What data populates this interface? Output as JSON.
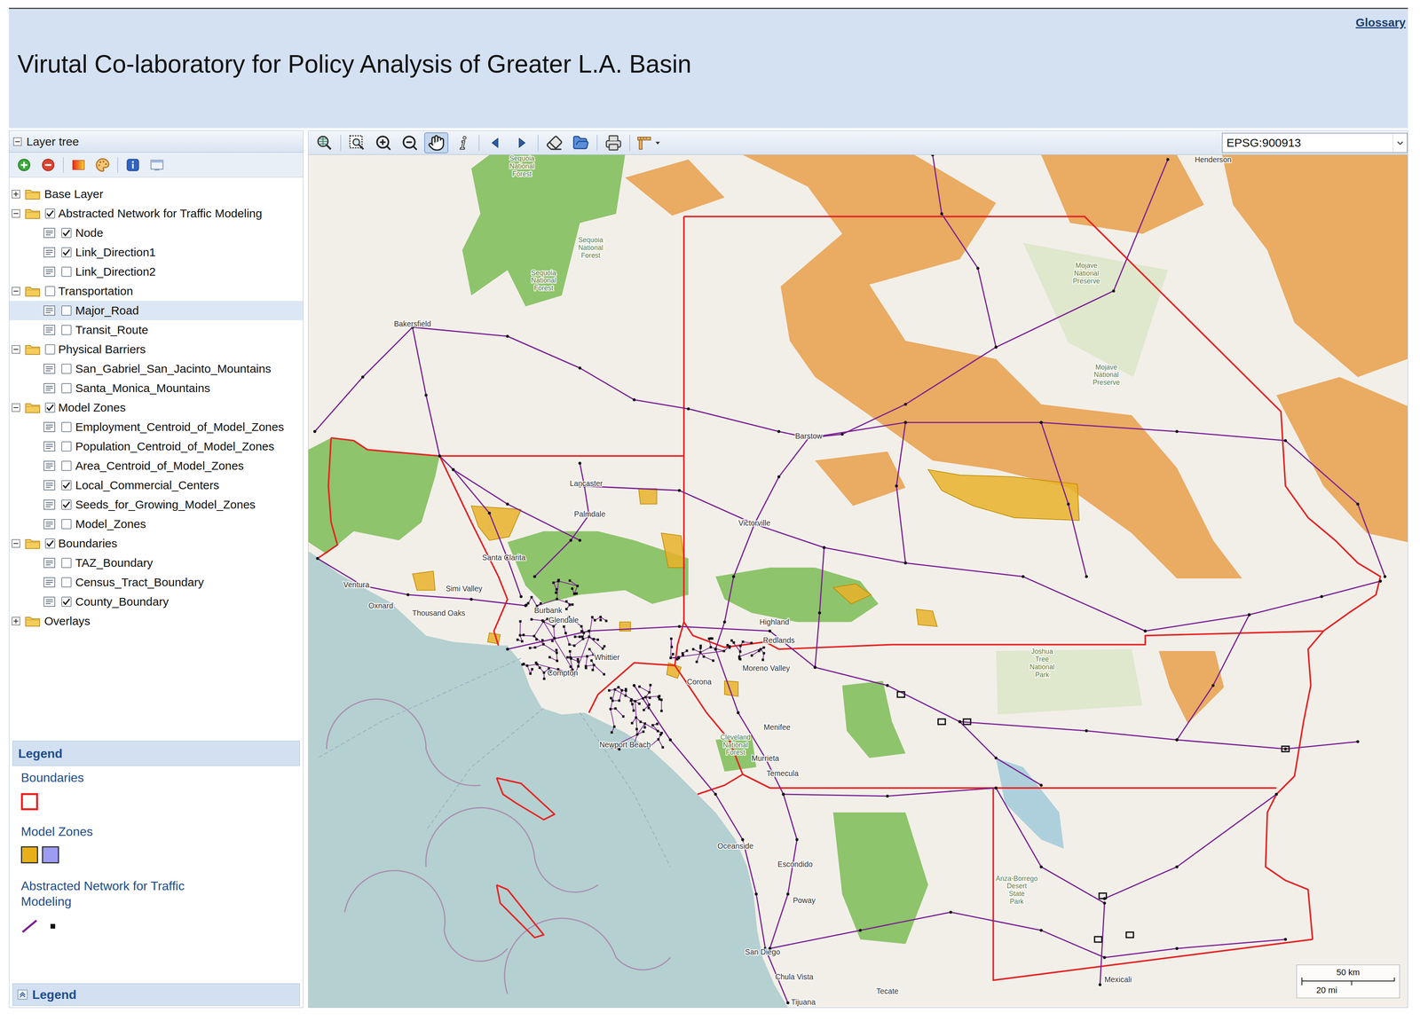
{
  "header": {
    "title": "Virutal Co-laboratory for Policy Analysis of Greater L.A. Basin",
    "glossary": "Glossary"
  },
  "layer_tree": {
    "title": "Layer tree",
    "expanded": true,
    "tools": [
      {
        "kind": "add"
      },
      {
        "kind": "remove"
      },
      {
        "kind": "color"
      },
      {
        "kind": "style"
      },
      {
        "kind": "info"
      },
      {
        "kind": "window"
      }
    ],
    "items": [
      {
        "label": "Base Layer",
        "kind": "group",
        "expanded": false,
        "selected": false
      },
      {
        "label": "Abstracted Network for Traffic Modeling",
        "kind": "folder",
        "expanded": true,
        "checked": true,
        "selected": false
      },
      {
        "label": "Node",
        "kind": "layer",
        "checked": true,
        "selected": false
      },
      {
        "label": "Link_Direction1",
        "kind": "layer",
        "checked": true,
        "selected": false
      },
      {
        "label": "Link_Direction2",
        "kind": "layer",
        "checked": false,
        "selected": false
      },
      {
        "label": "Transportation",
        "kind": "folder",
        "expanded": true,
        "checked": false,
        "selected": false
      },
      {
        "label": "Major_Road",
        "kind": "layer",
        "checked": false,
        "selected": true
      },
      {
        "label": "Transit_Route",
        "kind": "layer",
        "checked": false,
        "selected": false
      },
      {
        "label": "Physical Barriers",
        "kind": "folder",
        "expanded": true,
        "checked": false,
        "selected": false
      },
      {
        "label": "San_Gabriel_San_Jacinto_Mountains",
        "kind": "layer",
        "checked": false,
        "selected": false
      },
      {
        "label": "Santa_Monica_Mountains",
        "kind": "layer",
        "checked": false,
        "selected": false
      },
      {
        "label": "Model Zones",
        "kind": "folder",
        "expanded": true,
        "checked": true,
        "selected": false
      },
      {
        "label": "Employment_Centroid_of_Model_Zones",
        "kind": "layer",
        "checked": false,
        "selected": false
      },
      {
        "label": "Population_Centroid_of_Model_Zones",
        "kind": "layer",
        "checked": false,
        "selected": false
      },
      {
        "label": "Area_Centroid_of_Model_Zones",
        "kind": "layer",
        "checked": false,
        "selected": false
      },
      {
        "label": "Local_Commercial_Centers",
        "kind": "layer",
        "checked": true,
        "selected": false
      },
      {
        "label": "Seeds_for_Growing_Model_Zones",
        "kind": "layer",
        "checked": true,
        "selected": false
      },
      {
        "label": "Model_Zones",
        "kind": "layer",
        "checked": false,
        "selected": false
      },
      {
        "label": "Boundaries",
        "kind": "folder",
        "expanded": true,
        "checked": true,
        "selected": false
      },
      {
        "label": "TAZ_Boundary",
        "kind": "layer",
        "checked": false,
        "selected": false
      },
      {
        "label": "Census_Tract_Boundary",
        "kind": "layer",
        "checked": false,
        "selected": false
      },
      {
        "label": "County_Boundary",
        "kind": "layer",
        "checked": true,
        "selected": false
      },
      {
        "label": "Overlays",
        "kind": "group",
        "expanded": false,
        "selected": false
      }
    ]
  },
  "legend": {
    "title": "Legend",
    "footer": "Legend",
    "sections": [
      {
        "title": "Boundaries",
        "swatches": [
          {
            "kind": "outline",
            "color": "#e82323"
          }
        ]
      },
      {
        "title": "Model Zones",
        "swatches": [
          {
            "kind": "fill",
            "color": "#e8b018"
          },
          {
            "kind": "fill",
            "color": "#9c9cf2"
          }
        ]
      },
      {
        "title": "Abstracted Network for Traffic Modeling",
        "swatches": [
          {
            "kind": "line",
            "color": "#7b1f94"
          },
          {
            "kind": "dot",
            "color": "#111111"
          }
        ]
      }
    ]
  },
  "map_toolbar": {
    "tool_groups": [
      [
        {
          "kind": "zoom-extent",
          "selected": false
        }
      ],
      [
        {
          "kind": "zoom-box",
          "selected": false
        },
        {
          "kind": "zoom-in",
          "selected": false
        },
        {
          "kind": "zoom-out",
          "selected": false
        },
        {
          "kind": "pan",
          "selected": true
        },
        {
          "kind": "info",
          "selected": false
        }
      ],
      [
        {
          "kind": "back",
          "selected": false
        },
        {
          "kind": "forward",
          "selected": false
        }
      ],
      [
        {
          "kind": "clear",
          "selected": false
        },
        {
          "kind": "open",
          "selected": false
        }
      ],
      [
        {
          "kind": "print",
          "selected": false
        }
      ],
      [
        {
          "kind": "measure",
          "selected": false
        }
      ]
    ],
    "projection": "EPSG:900913"
  },
  "map": {
    "labels": [
      {
        "text": "Henderson",
        "kind": "city"
      },
      {
        "text": "Sequoia National Forest",
        "kind": "park"
      },
      {
        "text": "Sequoia National Forest",
        "kind": "park"
      },
      {
        "text": "Sequoia National Forest",
        "kind": "park"
      },
      {
        "text": "Mojave National Preserve",
        "kind": "park"
      },
      {
        "text": "Mojave National Preserve",
        "kind": "park"
      },
      {
        "text": "Bakersfield",
        "kind": "city"
      },
      {
        "text": "Barstow",
        "kind": "city"
      },
      {
        "text": "Lancaster",
        "kind": "city"
      },
      {
        "text": "Palmdale",
        "kind": "city"
      },
      {
        "text": "Victorville",
        "kind": "city"
      },
      {
        "text": "Santa Clarita",
        "kind": "city"
      },
      {
        "text": "Ventura",
        "kind": "city"
      },
      {
        "text": "Oxnard",
        "kind": "city"
      },
      {
        "text": "Simi Valley",
        "kind": "city"
      },
      {
        "text": "Thousand Oaks",
        "kind": "city"
      },
      {
        "text": "Burbank",
        "kind": "city"
      },
      {
        "text": "Glendale",
        "kind": "city"
      },
      {
        "text": "Highland",
        "kind": "city"
      },
      {
        "text": "Redlands",
        "kind": "city"
      },
      {
        "text": "Moreno Valley",
        "kind": "city"
      },
      {
        "text": "Corona",
        "kind": "city"
      },
      {
        "text": "Compton",
        "kind": "city"
      },
      {
        "text": "Whittier",
        "kind": "city"
      },
      {
        "text": "Menifee",
        "kind": "city"
      },
      {
        "text": "Murrieta",
        "kind": "city"
      },
      {
        "text": "Temecula",
        "kind": "city"
      },
      {
        "text": "Joshua Tree National Park",
        "kind": "park"
      },
      {
        "text": "Cleveland National Forest",
        "kind": "park"
      },
      {
        "text": "Newport Beach",
        "kind": "city"
      },
      {
        "text": "Oceanside",
        "kind": "city"
      },
      {
        "text": "Escondido",
        "kind": "city"
      },
      {
        "text": "Poway",
        "kind": "city"
      },
      {
        "text": "Anza-Borrego Desert State Park",
        "kind": "park"
      },
      {
        "text": "San Diego",
        "kind": "city"
      },
      {
        "text": "Chula Vista",
        "kind": "city"
      },
      {
        "text": "Tijuana",
        "kind": "city"
      },
      {
        "text": "Tecate",
        "kind": "city"
      },
      {
        "text": "Mexicali",
        "kind": "city"
      }
    ],
    "scale": {
      "km": "50 km",
      "mi": "20 mi"
    }
  }
}
